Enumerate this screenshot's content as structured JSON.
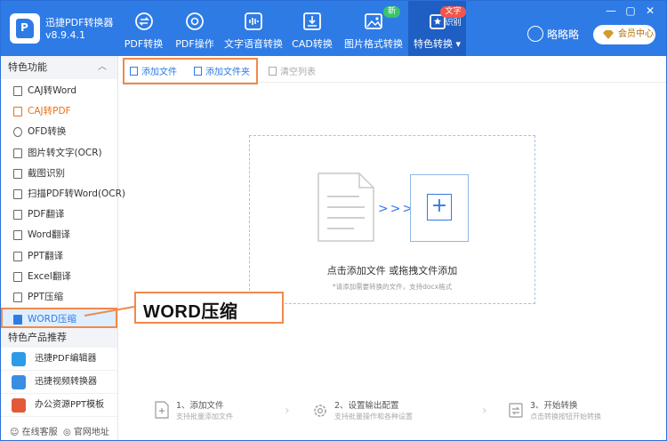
{
  "app": {
    "name": "迅捷PDF转换器",
    "version": "v8.9.4.1"
  },
  "nav": [
    {
      "label": "PDF转换"
    },
    {
      "label": "PDF操作"
    },
    {
      "label": "文字语音转换"
    },
    {
      "label": "CAD转换"
    },
    {
      "label": "图片格式转换",
      "badge": "新"
    },
    {
      "label": "特色转换",
      "badge": "文字识别"
    }
  ],
  "user": {
    "name": "略略略",
    "vip_label": "会员中心"
  },
  "sidebar": {
    "header": "特色功能",
    "items": [
      {
        "label": "CAJ转Word"
      },
      {
        "label": "CAJ转PDF"
      },
      {
        "label": "OFD转换"
      },
      {
        "label": "图片转文字(OCR)"
      },
      {
        "label": "截图识别"
      },
      {
        "label": "扫描PDF转Word(OCR)"
      },
      {
        "label": "PDF翻译"
      },
      {
        "label": "Word翻译"
      },
      {
        "label": "PPT翻译"
      },
      {
        "label": "Excel翻译"
      },
      {
        "label": "PPT压缩"
      },
      {
        "label": "WORD压缩"
      }
    ],
    "products_header": "特色产品推荐",
    "products": [
      {
        "label": "迅捷PDF编辑器"
      },
      {
        "label": "迅捷视频转换器"
      },
      {
        "label": "办公资源PPT模板"
      }
    ],
    "footer": {
      "service": "在线客服",
      "website": "官网地址"
    }
  },
  "toolbar": {
    "add_file": "添加文件",
    "add_folder": "添加文件夹",
    "clear": "清空列表"
  },
  "dropzone": {
    "title": "点击添加文件 或拖拽文件添加",
    "subtitle": "*请添加需要转换的文件，支持docx格式"
  },
  "callout": "WORD压缩",
  "steps": [
    {
      "title": "1、添加文件",
      "desc": "支持批量添加文件"
    },
    {
      "title": "2、设置输出配置",
      "desc": "支持批量操作和各种设置"
    },
    {
      "title": "3、开始转换",
      "desc": "点击转换按钮开始转换"
    }
  ],
  "colors": {
    "brand": "#2e7be6",
    "highlight": "#f08a4b",
    "orange_text": "#e8711c"
  }
}
